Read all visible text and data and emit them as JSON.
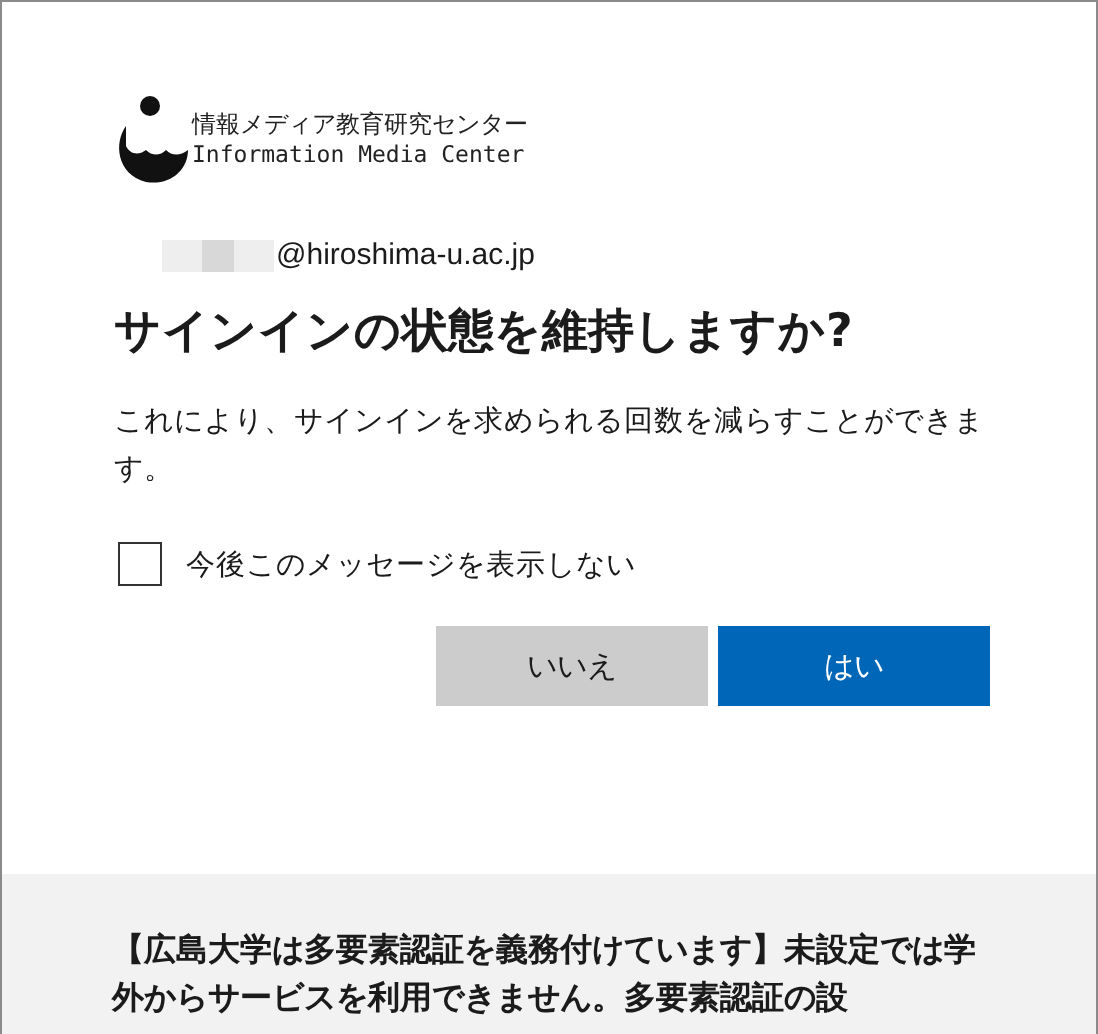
{
  "logo": {
    "title_ja": "情報メディア教育研究センター",
    "title_en": "Information Media Center"
  },
  "account": {
    "email_suffix": "@hiroshima-u.ac.jp"
  },
  "heading": "サインインの状態を維持しますか?",
  "description": "これにより、サインインを求められる回数を減らすことができます。",
  "checkbox": {
    "label": "今後このメッセージを表示しない",
    "checked": false
  },
  "buttons": [
    {
      "label": "いいえ",
      "kind": "secondary"
    },
    {
      "label": "はい",
      "kind": "primary"
    }
  ],
  "notice": "【広島大学は多要素認証を義務付けています】未設定では学外からサービスを利用できません。多要素認証の設"
}
